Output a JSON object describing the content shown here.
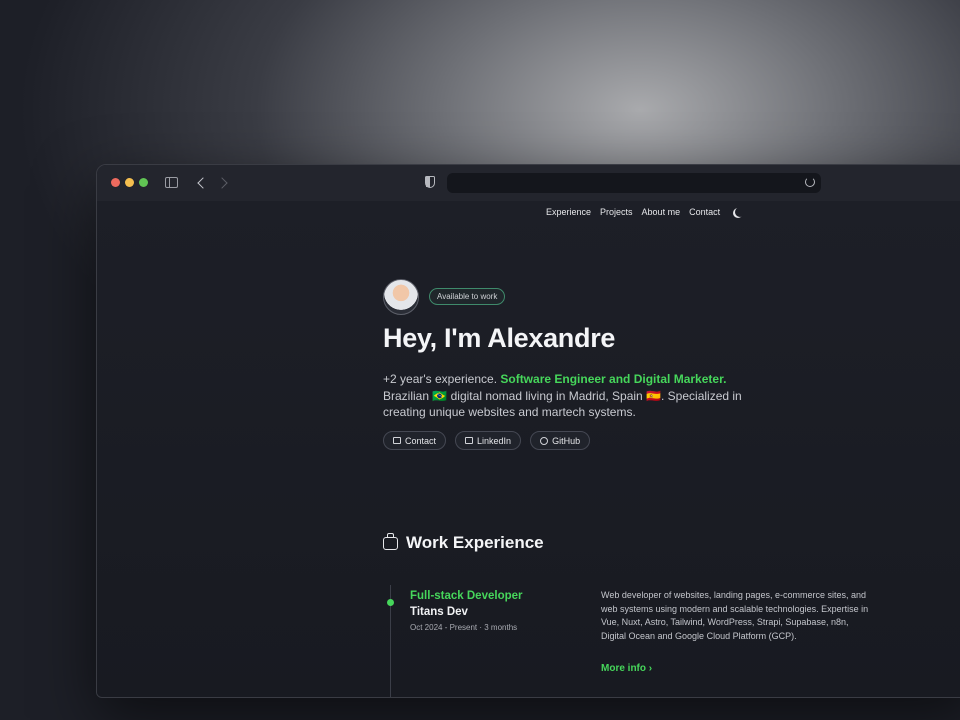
{
  "nav": {
    "items": [
      "Experience",
      "Projects",
      "About me",
      "Contact"
    ]
  },
  "hero": {
    "badge": "Available to work",
    "title": "Hey, I'm Alexandre",
    "desc_prefix": "+2 year's experience. ",
    "desc_highlight": "Software Engineer and Digital Marketer.",
    "desc_suffix": " Brazilian 🇧🇷 digital nomad living in Madrid, Spain 🇪🇸. Specialized in creating unique websites and martech systems.",
    "links": [
      "Contact",
      "LinkedIn",
      "GitHub"
    ]
  },
  "experience": {
    "title": "Work Experience",
    "jobs": [
      {
        "role": "Full-stack Developer",
        "company": "Titans Dev",
        "dates": "Oct 2024 - Present · 3 months",
        "description": "Web developer of websites, landing pages, e-commerce sites, and web systems using modern and scalable technologies. Expertise in Vue, Nuxt, Astro, Tailwind, WordPress, Strapi, Supabase, n8n, Digital Ocean and Google Cloud Platform (GCP).",
        "more": "More info ›"
      }
    ]
  },
  "colors": {
    "accent": "#46d65b",
    "background": "#1c1e26"
  }
}
